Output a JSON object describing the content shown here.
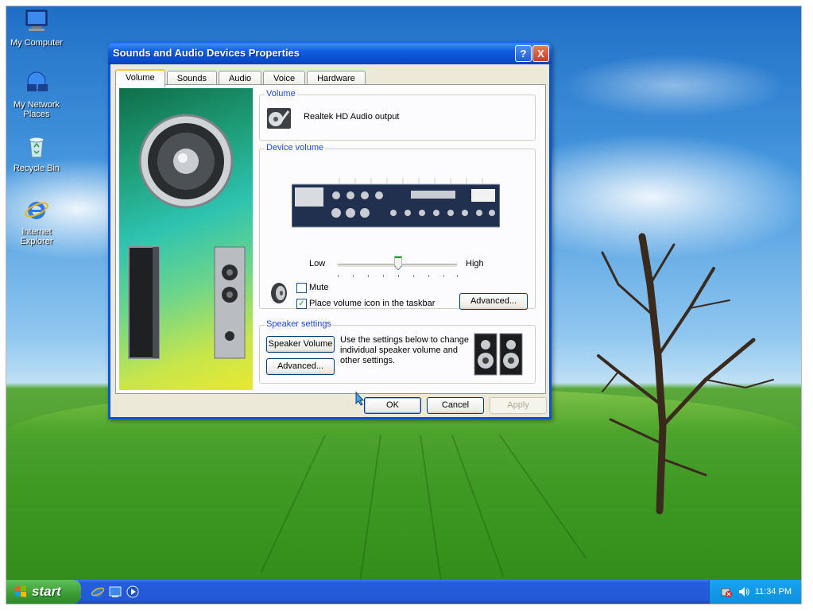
{
  "desktop": {
    "icons": [
      {
        "label": "My Computer"
      },
      {
        "label": "My Network Places"
      },
      {
        "label": "Recycle Bin"
      },
      {
        "label": "Internet Explorer"
      }
    ]
  },
  "dialog": {
    "title": "Sounds and Audio Devices Properties",
    "help_label": "?",
    "close_label": "X",
    "tabs": [
      {
        "label": "Volume",
        "active": true
      },
      {
        "label": "Sounds",
        "active": false
      },
      {
        "label": "Audio",
        "active": false
      },
      {
        "label": "Voice",
        "active": false
      },
      {
        "label": "Hardware",
        "active": false
      }
    ],
    "volume_group": {
      "label": "Volume",
      "device_name": "Realtek HD Audio output"
    },
    "device_volume": {
      "label": "Device volume",
      "low_label": "Low",
      "high_label": "High",
      "slider_value": 0.5,
      "mute_label": "Mute",
      "mute_checked": false,
      "taskbar_icon_label": "Place volume icon in the taskbar",
      "taskbar_icon_checked": true,
      "advanced_label": "Advanced..."
    },
    "speaker_settings": {
      "label": "Speaker settings",
      "speaker_volume_label": "Speaker Volume",
      "advanced_label": "Advanced...",
      "description": [
        "Use the settings below to change",
        "individual speaker volume and",
        "other settings."
      ]
    },
    "buttons": {
      "ok": "OK",
      "cancel": "Cancel",
      "apply": "Apply"
    }
  },
  "taskbar": {
    "start_label": "start",
    "clock": "11:34 PM"
  },
  "colors": {
    "title_blue": "#0a53d9",
    "dialog_bg": "#ece9d8",
    "start_green": "#3b9c34",
    "group_label_blue": "#1c4ad8"
  }
}
